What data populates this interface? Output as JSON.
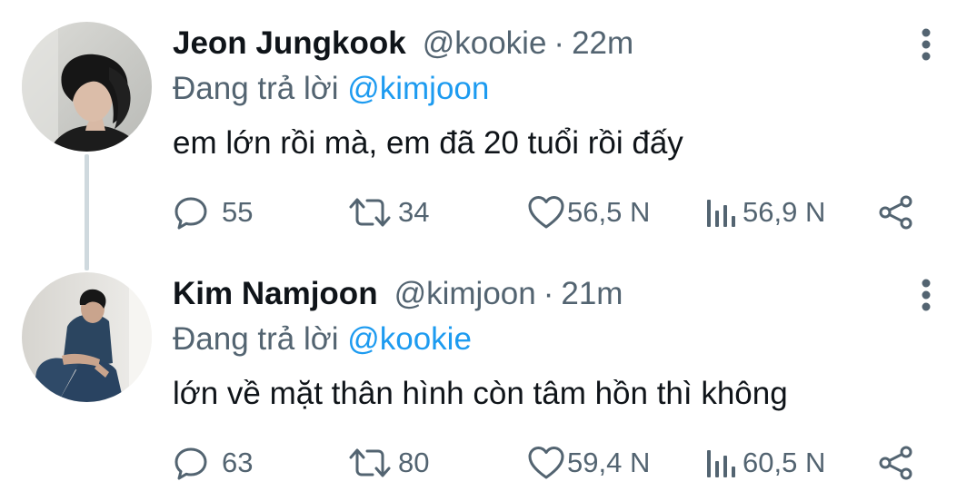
{
  "reply_prefix": "Đang trả lời ",
  "separator": "·",
  "icons": {
    "reply": "reply-icon",
    "retweet": "retweet-icon",
    "like": "heart-icon",
    "views": "views-icon",
    "share": "share-icon",
    "more": "more-options-icon"
  },
  "colors": {
    "name": "#0f1419",
    "secondary": "#536471",
    "mention": "#1d9bf0",
    "thread_line": "#cfd9de"
  },
  "tweets": [
    {
      "display_name": "Jeon Jungkook",
      "handle": "@kookie",
      "time": "22m",
      "reply_to": "@kimjoon",
      "text": "em lớn rồi mà, em đã 20 tuổi rồi đấy",
      "replies": "55",
      "retweets": "34",
      "likes": "56,5 N",
      "views": "56,9 N"
    },
    {
      "display_name": "Kim Namjoon",
      "handle": "@kimjoon",
      "time": "21m",
      "reply_to": "@kookie",
      "text": "lớn về mặt thân hình còn tâm hồn thì không",
      "replies": "63",
      "retweets": "80",
      "likes": "59,4 N",
      "views": "60,5 N"
    }
  ]
}
